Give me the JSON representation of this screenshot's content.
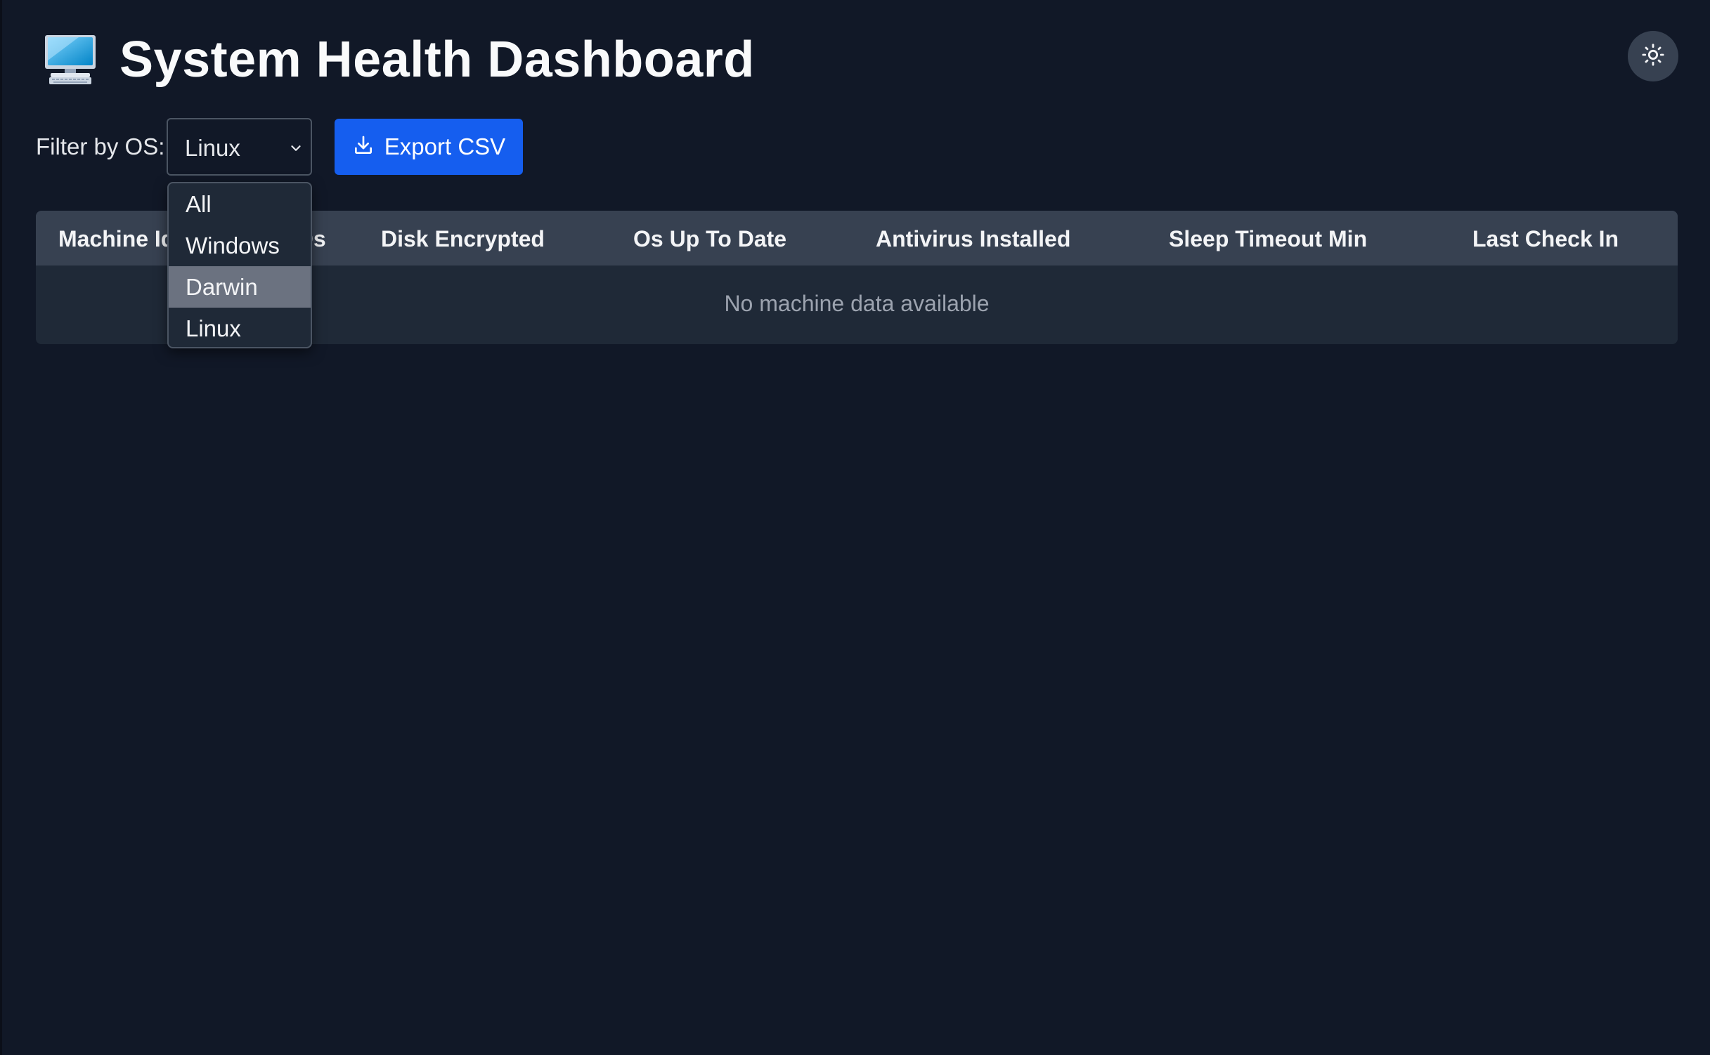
{
  "header": {
    "title": "System Health Dashboard",
    "logo_icon": "desktop-computer-icon",
    "theme_toggle_icon": "sun-icon"
  },
  "toolbar": {
    "filter_label": "Filter by OS:",
    "os_select": {
      "selected": "Linux",
      "options": [
        "All",
        "Windows",
        "Darwin",
        "Linux"
      ],
      "highlighted": "Darwin"
    },
    "export_label": "Export CSV",
    "export_icon": "download-icon"
  },
  "table": {
    "columns": [
      "Machine Id",
      "Os",
      "Disk Encrypted",
      "Os Up To Date",
      "Antivirus Installed",
      "Sleep Timeout Min",
      "Last Check In"
    ],
    "empty_message": "No machine data available"
  },
  "colors": {
    "background": "#111827",
    "header_row": "#374151",
    "body_row": "#1f2937",
    "accent": "#155eef"
  }
}
